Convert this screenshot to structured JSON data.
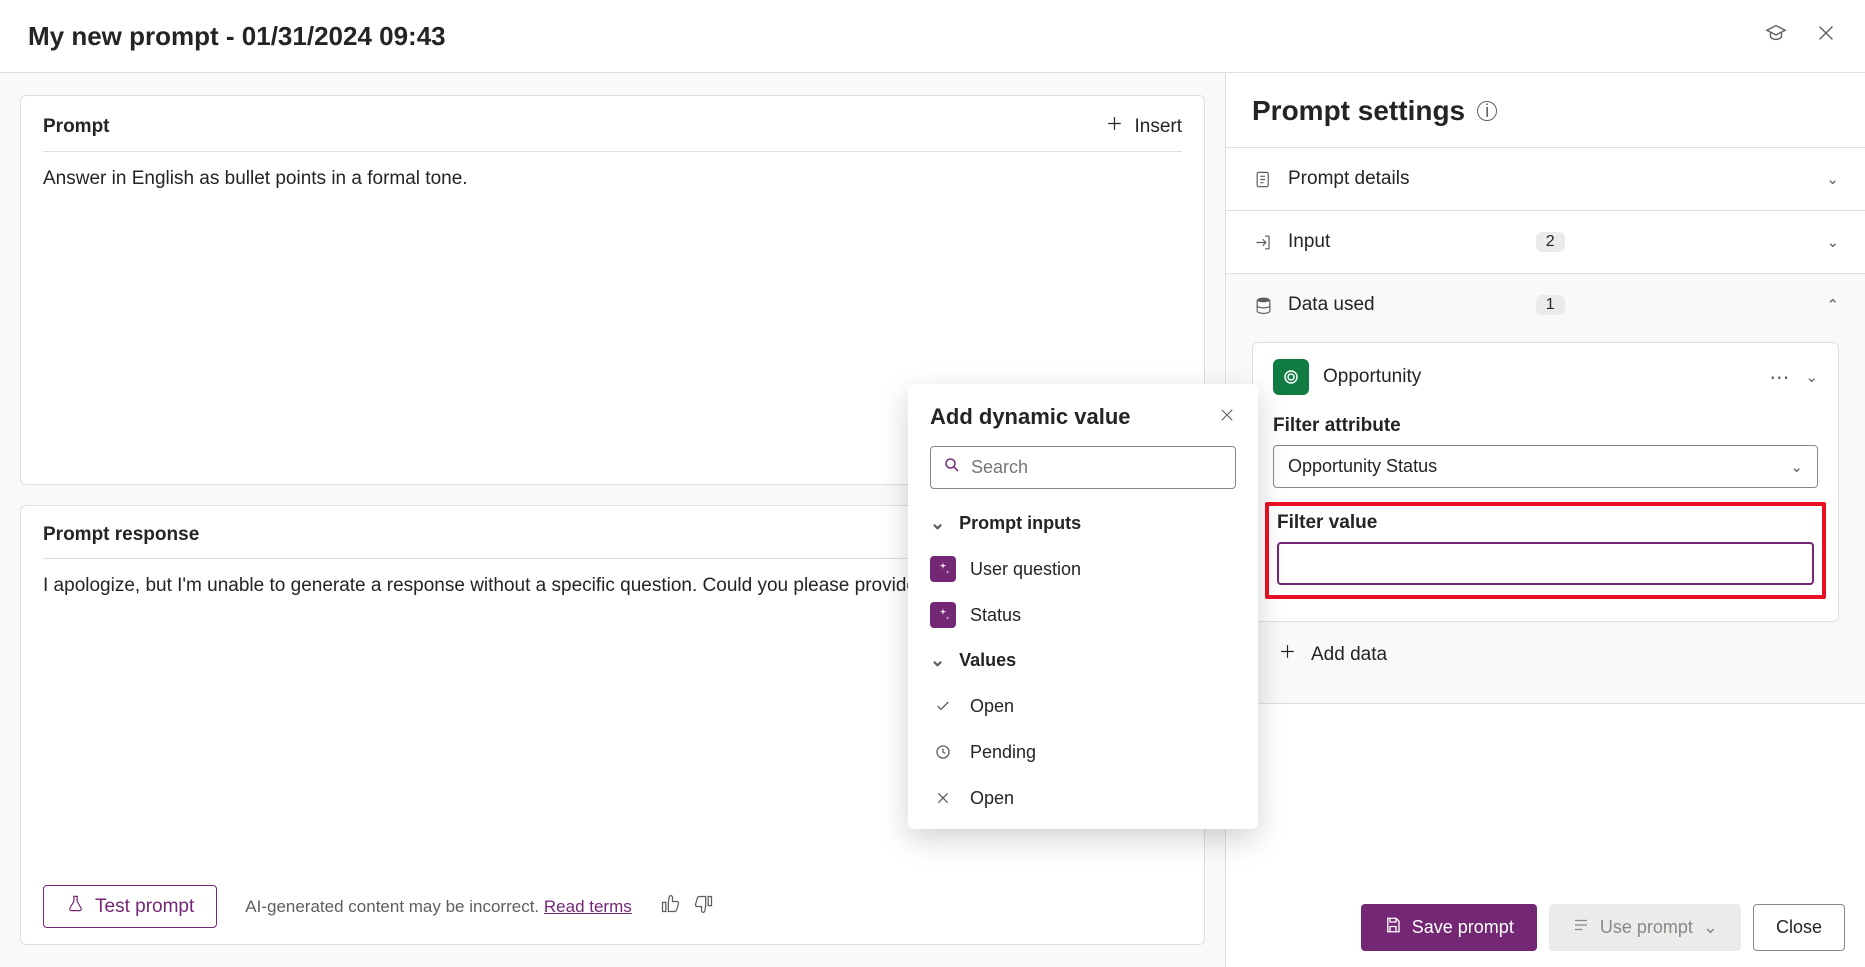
{
  "header": {
    "title": "My new prompt - 01/31/2024 09:43"
  },
  "prompt_card": {
    "title": "Prompt",
    "insert_label": "Insert",
    "text": "Answer in English as bullet points in a formal tone."
  },
  "response_card": {
    "title": "Prompt response",
    "text": "I apologize, but I'm unable to generate a response without a specific question. Could you please provide more de",
    "test_label": "Test prompt",
    "disclaimer": "AI-generated content may be incorrect.",
    "read_terms": "Read terms"
  },
  "popup": {
    "title": "Add dynamic value",
    "search_placeholder": "Search",
    "sections": {
      "inputs_label": "Prompt inputs",
      "values_label": "Values"
    },
    "inputs": [
      {
        "label": "User question"
      },
      {
        "label": "Status"
      }
    ],
    "values": [
      {
        "icon": "check",
        "label": "Open"
      },
      {
        "icon": "clock",
        "label": "Pending"
      },
      {
        "icon": "x",
        "label": "Open"
      }
    ]
  },
  "settings": {
    "title": "Prompt settings",
    "sections": {
      "details": {
        "label": "Prompt details"
      },
      "input": {
        "label": "Input",
        "count": "2"
      },
      "data": {
        "label": "Data used",
        "count": "1"
      }
    },
    "data_entity": {
      "name": "Opportunity",
      "filter_attr_label": "Filter attribute",
      "filter_attr_value": "Opportunity Status",
      "filter_value_label": "Filter value",
      "filter_value": ""
    },
    "add_data_label": "Add data"
  },
  "footer": {
    "save": "Save prompt",
    "use": "Use prompt",
    "close": "Close"
  }
}
